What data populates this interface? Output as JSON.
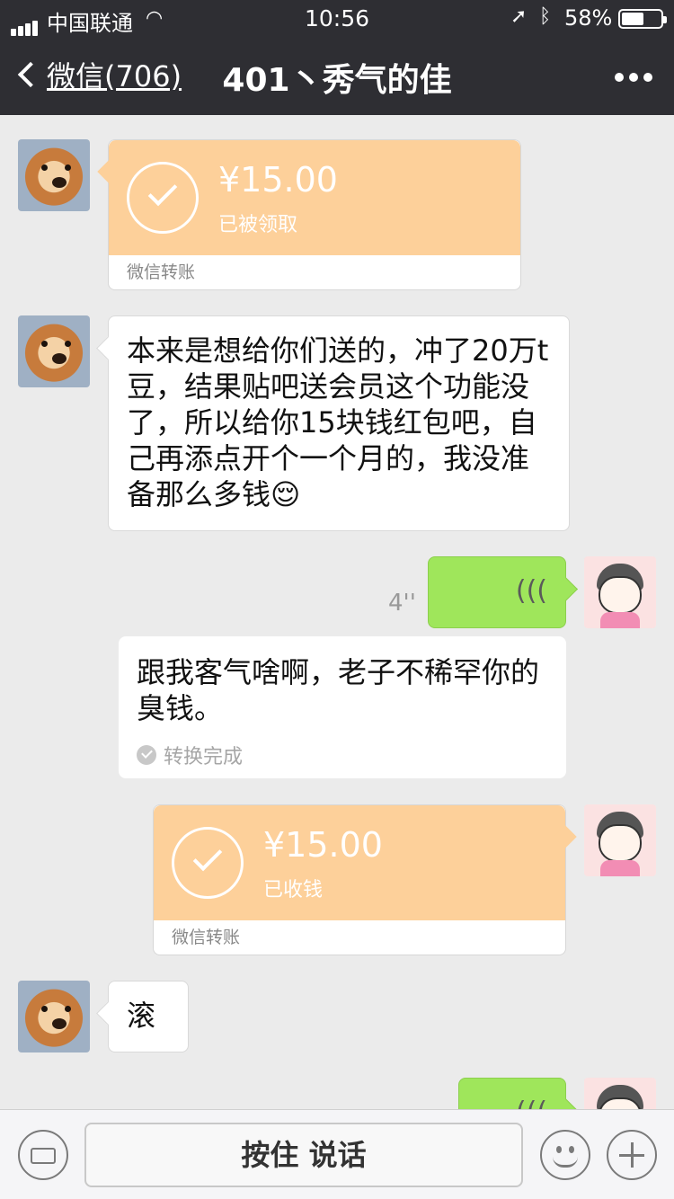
{
  "status_bar": {
    "carrier": "中国联通",
    "time": "10:56",
    "battery": "58%",
    "battery_level": 0.58
  },
  "nav": {
    "back_label": "微信(706)",
    "title": "401丶秀气的佳"
  },
  "messages": {
    "m1": {
      "amount": "¥15.00",
      "status": "已被领取",
      "footer": "微信转账"
    },
    "m2": {
      "text": "本来是想给你们送的，冲了20万t豆，结果贴吧送会员这个功能没了，所以给你15块钱红包吧，自己再添点开个一个月的，我没准备那么多钱",
      "emoji": "😌"
    },
    "m3": {
      "duration": "4''"
    },
    "m4": {
      "text": "跟我客气啥啊，老子不稀罕你的臭钱。",
      "done": "转换完成"
    },
    "m5": {
      "amount": "¥15.00",
      "status": "已收钱",
      "footer": "微信转账"
    },
    "m6": {
      "text": "滚"
    }
  },
  "input_bar": {
    "hold_to_talk": "按住 说话"
  },
  "colors": {
    "header": "#2e2e33",
    "transfer": "#fdd09a",
    "green_bubble": "#9fe65b",
    "background": "#ebebeb"
  }
}
